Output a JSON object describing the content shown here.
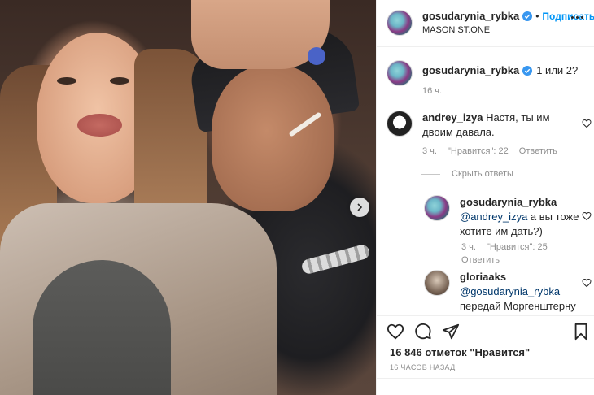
{
  "header": {
    "username": "gosudarynia_rybka",
    "separator": "•",
    "follow_label": "Подписаться",
    "location": "MASON ST.ONE"
  },
  "caption": {
    "username": "gosudarynia_rybka",
    "text": "1 или 2?",
    "time": "16 ч."
  },
  "comments": [
    {
      "username": "andrey_izya",
      "text": "Настя, ты им двоим давала.",
      "time": "3 ч.",
      "likes": "\"Нравится\": 22",
      "reply": "Ответить"
    }
  ],
  "hide_replies_label": "Скрыть ответы",
  "replies": [
    {
      "username": "gosudarynia_rybka",
      "mention": "@andrey_izya",
      "text": "а вы тоже хотите им дать?)",
      "time": "3 ч.",
      "likes": "\"Нравится\": 25",
      "reply": "Ответить"
    },
    {
      "username": "gloriaaks",
      "mention": "@gosudarynia_rybka",
      "text": "передай Моргенштерну"
    }
  ],
  "footer": {
    "likes": "16 846 отметок \"Нравится\"",
    "time_ago": "16 ЧАСОВ НАЗАД"
  },
  "colors": {
    "accent": "#0095f6",
    "mention": "#00376b",
    "muted": "#8e8e8e",
    "text": "#262626"
  }
}
